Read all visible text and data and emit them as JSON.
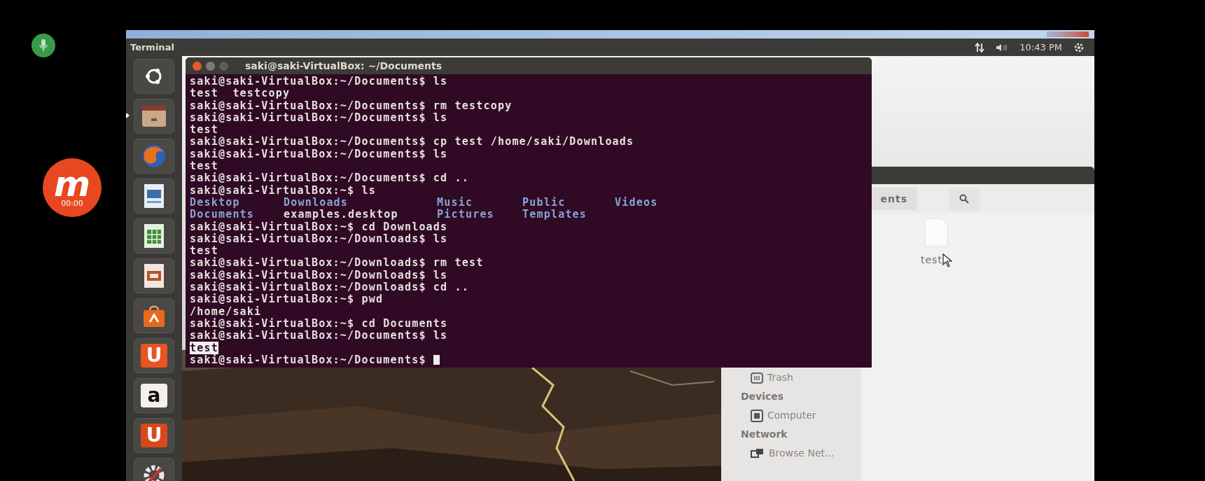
{
  "recorder": {
    "logo_letter": "m",
    "timer": "00:00"
  },
  "vm_window": {
    "panel": {
      "app_title": "Terminal",
      "clock": "10:43 PM"
    },
    "launcher": [
      {
        "kind": "dash",
        "running": false
      },
      {
        "kind": "files",
        "running": true
      },
      {
        "kind": "browser",
        "running": false
      },
      {
        "kind": "writer",
        "running": false
      },
      {
        "kind": "calc",
        "running": false
      },
      {
        "kind": "impress",
        "running": false
      },
      {
        "kind": "software",
        "running": false
      },
      {
        "kind": "letter",
        "label": "U",
        "color": "#e9541f",
        "running": false
      },
      {
        "kind": "letter",
        "label": "a",
        "color": "#f4f1ea",
        "running": false
      },
      {
        "kind": "letter",
        "label": "U",
        "color": "#d9481c",
        "running": false
      },
      {
        "kind": "settings",
        "running": false
      }
    ],
    "terminal": {
      "title": "saki@saki-VirtualBox: ~/Documents",
      "lines": [
        {
          "kind": "plain",
          "text": "saki@saki-VirtualBox:~/Documents$ ls"
        },
        {
          "kind": "plain",
          "text": "test  testcopy"
        },
        {
          "kind": "plain",
          "text": "saki@saki-VirtualBox:~/Documents$ rm testcopy"
        },
        {
          "kind": "plain",
          "text": "saki@saki-VirtualBox:~/Documents$ ls"
        },
        {
          "kind": "plain",
          "text": "test"
        },
        {
          "kind": "plain",
          "text": "saki@saki-VirtualBox:~/Documents$ cp test /home/saki/Downloads"
        },
        {
          "kind": "plain",
          "text": "saki@saki-VirtualBox:~/Documents$ ls"
        },
        {
          "kind": "plain",
          "text": "test"
        },
        {
          "kind": "plain",
          "text": "saki@saki-VirtualBox:~/Documents$ cd .."
        },
        {
          "kind": "plain",
          "text": "saki@saki-VirtualBox:~$ ls"
        },
        {
          "kind": "listing",
          "items": [
            {
              "text": "Desktop",
              "kind": "dir"
            },
            {
              "text": "Downloads",
              "kind": "dir"
            },
            {
              "text": "Music",
              "kind": "dir"
            },
            {
              "text": "Public",
              "kind": "dir"
            },
            {
              "text": "Videos",
              "kind": "dir"
            }
          ]
        },
        {
          "kind": "listing",
          "items": [
            {
              "text": "Documents",
              "kind": "dir"
            },
            {
              "text": "examples.desktop",
              "kind": "file"
            },
            {
              "text": "Pictures",
              "kind": "dir"
            },
            {
              "text": "Templates",
              "kind": "dir"
            }
          ]
        },
        {
          "kind": "plain",
          "text": "saki@saki-VirtualBox:~$ cd Downloads"
        },
        {
          "kind": "plain",
          "text": "saki@saki-VirtualBox:~/Downloads$ ls"
        },
        {
          "kind": "plain",
          "text": "test"
        },
        {
          "kind": "plain",
          "text": "saki@saki-VirtualBox:~/Downloads$ rm test"
        },
        {
          "kind": "plain",
          "text": "saki@saki-VirtualBox:~/Downloads$ ls"
        },
        {
          "kind": "plain",
          "text": "saki@saki-VirtualBox:~/Downloads$ cd .."
        },
        {
          "kind": "plain",
          "text": "saki@saki-VirtualBox:~$ pwd"
        },
        {
          "kind": "plain",
          "text": "/home/saki"
        },
        {
          "kind": "plain",
          "text": "saki@saki-VirtualBox:~$ cd Documents"
        },
        {
          "kind": "plain",
          "text": "saki@saki-VirtualBox:~/Documents$ ls"
        },
        {
          "kind": "selected",
          "text": "test"
        },
        {
          "kind": "cursor",
          "text": "saki@saki-VirtualBox:~/Documents$"
        }
      ]
    },
    "file_manager": {
      "breadcrumb": "ents",
      "files": [
        {
          "name": "test"
        }
      ],
      "sidebar": [
        {
          "kind": "trash",
          "label": "Trash"
        },
        {
          "kind": "header",
          "label": "Devices"
        },
        {
          "kind": "computer",
          "label": "Computer"
        },
        {
          "kind": "header",
          "label": "Network"
        },
        {
          "kind": "network",
          "label": "Browse Net..."
        }
      ]
    }
  }
}
